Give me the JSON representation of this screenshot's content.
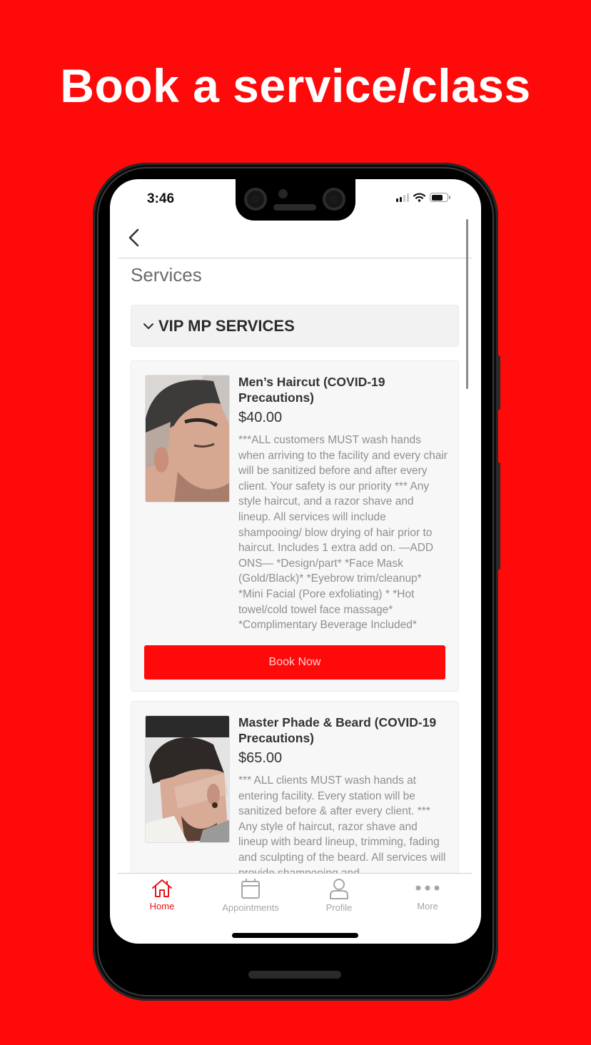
{
  "headline": "Book a service/class",
  "status_bar": {
    "time": "3:46"
  },
  "page": {
    "title": "Services"
  },
  "category": {
    "label": "VIP MP SERVICES",
    "expanded": true
  },
  "services": [
    {
      "name": "Men’s Haircut (COVID-19 Precautions)",
      "price": "$40.00",
      "description": "***ALL customers MUST wash hands when arriving to the facility and every chair will be sanitized before and after every client. Your safety is our priority *** Any style haircut, and a razor shave and lineup. All services will include shampooing/ blow drying of hair prior to haircut. Includes 1 extra add on. —ADD ONS— *Design/part* *Face Mask (Gold/Black)* *Eyebrow trim/cleanup* *Mini Facial (Pore exfoliating) * *Hot towel/cold towel face massage* *Complimentary Beverage Included*",
      "book_label": "Book Now"
    },
    {
      "name": "Master Phade & Beard (COVID-19 Precautions)",
      "price": "$65.00",
      "description": "*** ALL clients MUST wash hands at entering facility. Every station will be sanitized before & after every client. *** Any style of haircut, razor shave and lineup with beard lineup, trimming, fading and sculpting of the beard. All services will provide shampooing and"
    }
  ],
  "tabbar": {
    "items": [
      {
        "label": "Home",
        "icon": "home-icon",
        "active": true
      },
      {
        "label": "Appointments",
        "icon": "calendar-icon",
        "active": false
      },
      {
        "label": "Profile",
        "icon": "person-icon",
        "active": false
      },
      {
        "label": "More",
        "icon": "more-dots-icon",
        "active": false
      }
    ]
  },
  "colors": {
    "brand_red": "#ff0a0a",
    "active_tab": "#e8141b",
    "inactive_tab": "#a6a6a6"
  }
}
